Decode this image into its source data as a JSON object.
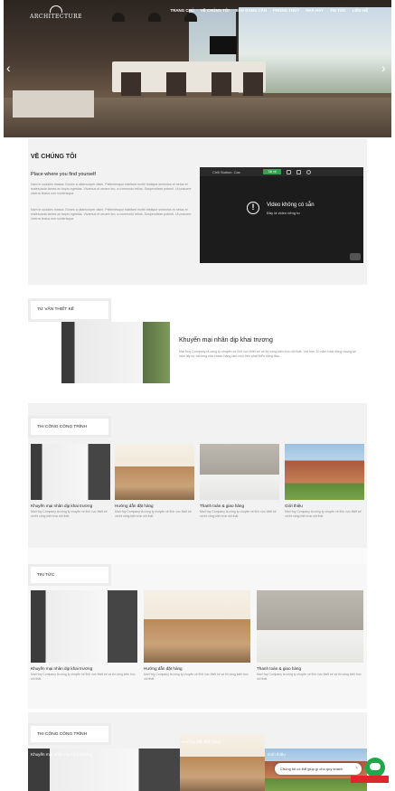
{
  "header": {
    "logo_text": "ARCHITECTURE",
    "nav": [
      "TRANG CHỦ",
      "VỀ CHÚNG TÔI",
      "BẠN DANG CẦN",
      "PHONG THỦY",
      "NHÀ HAY",
      "TIN TỨC",
      "LIÊN HỆ"
    ],
    "prev_arrow": "‹",
    "next_arrow": "›"
  },
  "about": {
    "heading": "VỀ CHÚNG TÔI",
    "subheading": "Place where you find yourself",
    "para1": "Nam in sodales massa. Donec a ullamcorper diam. Pellentesque habitant morbi tristique senectus et netus et malesuada fames ac turpis egestas. Vivamus et ornare leo, a commodo tellus. Suspendisse potenti. Ut posuere viverra lectus non scelerisque.",
    "para2": "Nam in sodales massa. Donec a ullamcorper diam. Pellentesque habitant morbi tristique senectus et netus et malesuada fames ac turpis egestas. Vivamus et ornare leo, a commodo tellus. Suspendisse potenti. Ut posuere viverra lectus non scelerisque.",
    "video": {
      "bar_title": "Chill Station: Cas",
      "bar_pill": "Tải về",
      "message": "Video không có sẵn",
      "sub_message": "Đây là video riêng tư"
    }
  },
  "consult": {
    "tab": "TƯ VẤN THIẾT KẾ",
    "title": "Khuyến mại nhân dịp khai trương",
    "desc": "Mai Huy Company là công ty chuyên về lĩnh vực thiết kế và thi công kiến trúc nội thất. Với hơn 10 năm hoạt động chúng tôi luôn lấy sự hài lòng của khách hàng làm mục tiêu phát triển hàng đầu."
  },
  "build": {
    "tab": "THI CÔNG CÔNG TRÌNH",
    "cards": [
      {
        "title": "Khuyến mại nhân dịp khai trương",
        "desc": "Mai Huy Company là công ty chuyên về lĩnh vực thiết kế và thi công kiến trúc nội thất."
      },
      {
        "title": "Hướng dẫn đặt hàng",
        "desc": "Mai Huy Company là công ty chuyên về lĩnh vực thiết kế và thi công kiến trúc nội thất."
      },
      {
        "title": "Thanh toán & giao hàng",
        "desc": "Mai Huy Company là công ty chuyên về lĩnh vực thiết kế và thi công kiến trúc nội thất."
      },
      {
        "title": "Giới thiệu",
        "desc": "Mai Huy Company là công ty chuyên về lĩnh vực thiết kế và thi công kiến trúc nội thất."
      }
    ]
  },
  "news": {
    "tab": "TIN TỨC",
    "cards": [
      {
        "title": "Khuyến mại nhân dịp khai trương",
        "desc": "Mai Huy Company là công ty chuyên về lĩnh vực thiết kế và thi công kiến trúc nội thất."
      },
      {
        "title": "Hướng dẫn đặt hàng",
        "desc": "Mai Huy Company là công ty chuyên về lĩnh vực thiết kế và thi công kiến trúc nội thất."
      },
      {
        "title": "Thanh toán & giao hàng",
        "desc": "Mai Huy Company là công ty chuyên về lĩnh vực thiết kế và thi công kiến trúc nội thất."
      }
    ]
  },
  "build2": {
    "tab": "THI CÔNG CÔNG TRÌNH",
    "overlay_titles": [
      "Khuyến mại nhân dịp khai trương",
      "Hướng dẫn đặt hàng",
      "Giới thiệu"
    ]
  },
  "chat": {
    "text": "Chúng tôi có thể giúp gì cho quý khách",
    "close": "×"
  }
}
